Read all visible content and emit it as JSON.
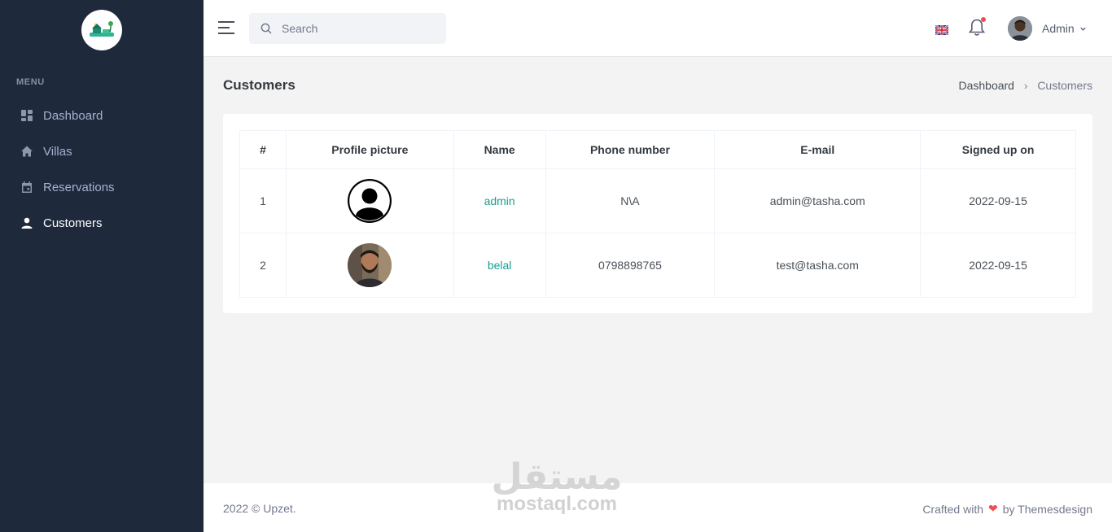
{
  "sidebar": {
    "menu_title": "MENU",
    "items": [
      {
        "label": "Dashboard",
        "icon": "dashboard-icon"
      },
      {
        "label": "Villas",
        "icon": "home-icon"
      },
      {
        "label": "Reservations",
        "icon": "calendar-icon"
      },
      {
        "label": "Customers",
        "icon": "user-icon"
      }
    ],
    "active": "Customers"
  },
  "topbar": {
    "search_placeholder": "Search",
    "language": "UK flag",
    "user_name": "Admin"
  },
  "page": {
    "title": "Customers",
    "breadcrumb": [
      "Dashboard",
      "Customers"
    ]
  },
  "table": {
    "headers": [
      "#",
      "Profile picture",
      "Name",
      "Phone number",
      "E-mail",
      "Signed up on"
    ],
    "rows": [
      {
        "index": "1",
        "avatar": "default-avatar",
        "name": "admin",
        "phone": "N\\A",
        "email": "admin@tasha.com",
        "signed_up": "2022-09-15"
      },
      {
        "index": "2",
        "avatar": "photo-avatar",
        "name": "belal",
        "phone": "0798898765",
        "email": "test@tasha.com",
        "signed_up": "2022-09-15"
      }
    ]
  },
  "footer": {
    "copyright": "2022 © Upzet.",
    "crafted_prefix": "Crafted with",
    "crafted_suffix": "by Themesdesign"
  },
  "watermark": {
    "arabic": "مستقل",
    "latin": "mostaql.com"
  },
  "colors": {
    "sidebar_bg": "#1e2a3c",
    "accent_link": "#1a9e8f",
    "notification_dot": "#f14c52"
  }
}
